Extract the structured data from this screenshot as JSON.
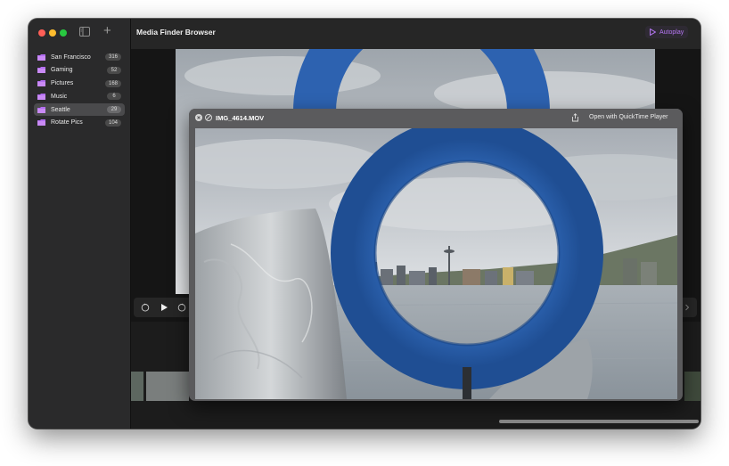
{
  "app": {
    "title": "Media Finder Browser",
    "autoplay_label": "Autoplay",
    "accent_color": "#b778f5"
  },
  "sidebar": {
    "items": [
      {
        "label": "San Francisco",
        "count": "316",
        "selected": false
      },
      {
        "label": "Gaming",
        "count": "52",
        "selected": false
      },
      {
        "label": "Pictures",
        "count": "168",
        "selected": false
      },
      {
        "label": "Music",
        "count": "6",
        "selected": false
      },
      {
        "label": "Seattle",
        "count": "29",
        "selected": true
      },
      {
        "label": "Rotate Pics",
        "count": "104",
        "selected": false
      }
    ]
  },
  "player": {
    "controls": [
      "skip-back-icon",
      "play-icon",
      "skip-forward-icon"
    ]
  },
  "quicklook": {
    "filename": "IMG_4614.MOV",
    "open_label": "Open with QuickTime Player"
  },
  "icons": {
    "sidebar_toggle": "sidebar-toggle-icon",
    "add": "plus-icon",
    "folder": "folder-icon",
    "close": "close-icon",
    "fullscreen": "fullscreen-icon",
    "share": "share-icon"
  }
}
